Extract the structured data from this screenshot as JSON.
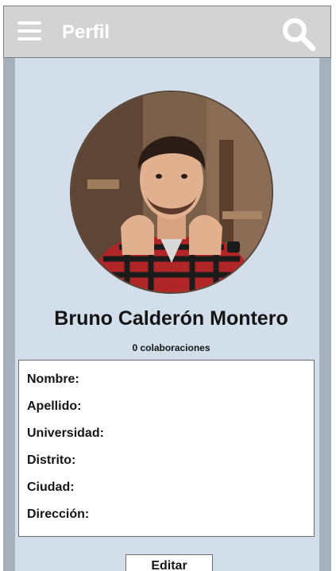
{
  "app_bar": {
    "title": "Perfil",
    "menu_icon": "hamburger-menu-icon",
    "search_icon": "search-icon",
    "background": "#d3d3d3"
  },
  "profile": {
    "avatar_icon": "profile-photo",
    "name": "Bruno Calderón Montero",
    "collaborations": "0 colaboraciones"
  },
  "info": {
    "fields": [
      {
        "label": "Nombre:"
      },
      {
        "label": "Apellido:"
      },
      {
        "label": "Universidad:"
      },
      {
        "label": "Distrito:"
      },
      {
        "label": "Ciudad:"
      },
      {
        "label": "Dirección:"
      }
    ]
  },
  "actions": {
    "edit_label": "Editar"
  },
  "colors": {
    "frame": "#a4b0bc",
    "content_background": "#d2deea",
    "text": "#151515"
  }
}
